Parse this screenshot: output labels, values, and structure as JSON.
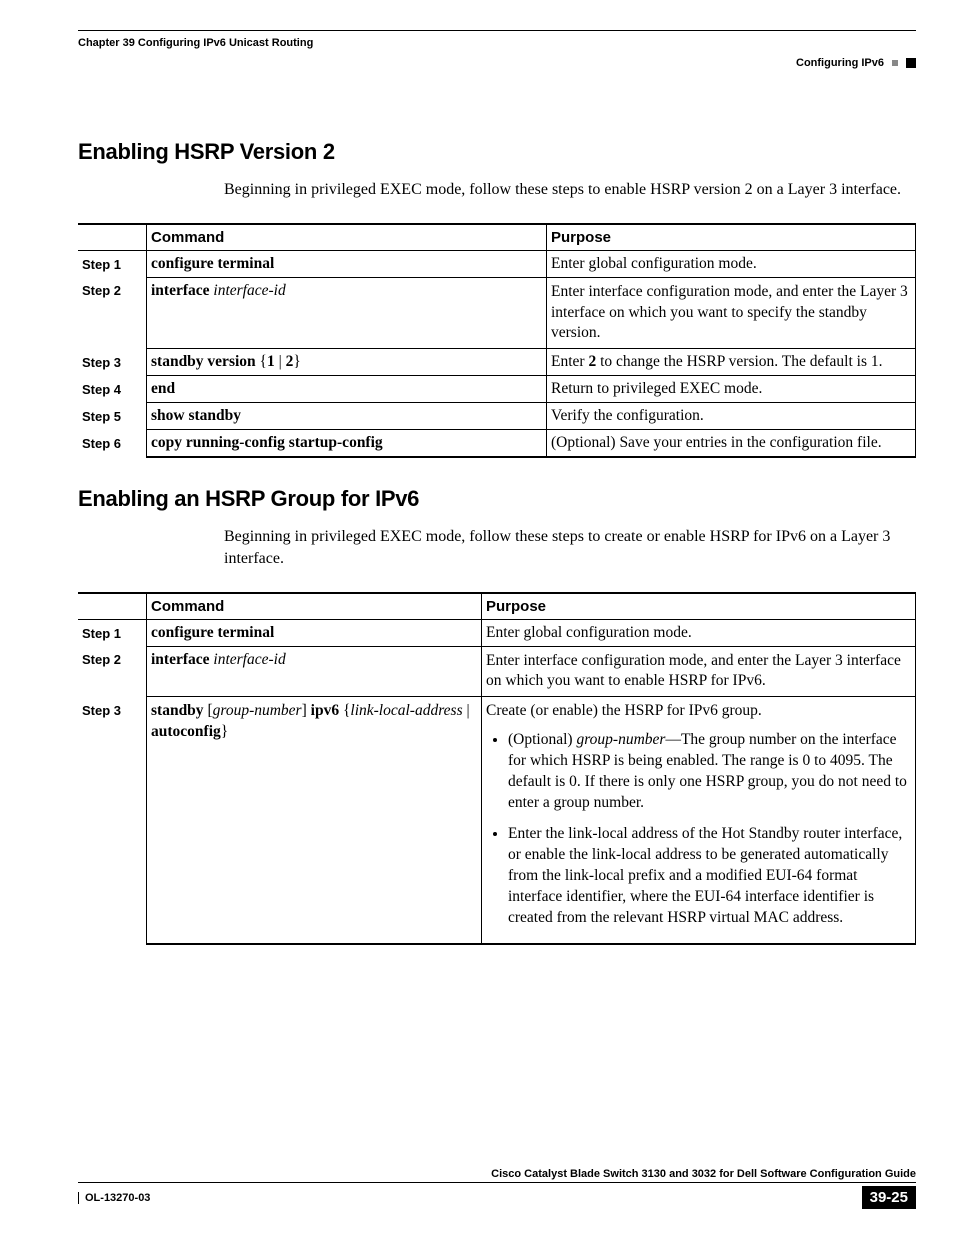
{
  "header": {
    "chapter": "Chapter 39      Configuring IPv6 Unicast Routing",
    "section": "Configuring IPv6"
  },
  "section1": {
    "title": "Enabling HSRP Version 2",
    "intro": "Beginning in privileged EXEC mode, follow these steps to enable HSRP version 2 on a Layer 3 interface.",
    "colCommand": "Command",
    "colPurpose": "Purpose",
    "steps": {
      "s1": "Step 1",
      "s2": "Step 2",
      "s3": "Step 3",
      "s4": "Step 4",
      "s5": "Step 5",
      "s6": "Step 6"
    },
    "row1": {
      "cmd_b": "configure terminal",
      "purpose": "Enter global configuration mode."
    },
    "row2": {
      "cmd_b": "interface",
      "cmd_i": " interface-id",
      "purpose": "Enter interface configuration mode, and enter the Layer 3 interface on which you want to specify the standby version."
    },
    "row3": {
      "cmd_b1": "standby version",
      "cmd_t1": " {",
      "cmd_b2": "1",
      "cmd_t2": " | ",
      "cmd_b3": "2",
      "cmd_t3": "}",
      "purpose_a": "Enter ",
      "purpose_b": "2",
      "purpose_c": " to change the HSRP version. The default is 1."
    },
    "row4": {
      "cmd_b": "end",
      "purpose": "Return to privileged EXEC mode."
    },
    "row5": {
      "cmd_b": "show standby",
      "purpose": "Verify the configuration."
    },
    "row6": {
      "cmd_b": "copy running-config startup-config",
      "purpose": "(Optional) Save your entries in the configuration file."
    }
  },
  "section2": {
    "title": "Enabling an HSRP Group for IPv6",
    "intro": "Beginning in privileged EXEC mode, follow these steps to create or enable HSRP for IPv6 on a Layer 3 interface.",
    "colCommand": "Command",
    "colPurpose": "Purpose",
    "steps": {
      "s1": "Step 1",
      "s2": "Step 2",
      "s3": "Step 3"
    },
    "row1": {
      "cmd_b": "configure terminal",
      "purpose": "Enter global configuration mode."
    },
    "row2": {
      "cmd_b": "interface",
      "cmd_i": " interface-id",
      "purpose": "Enter interface configuration mode, and enter the Layer 3 interface on which you want to enable HSRP for IPv6."
    },
    "row3": {
      "cmd_b1": "standby",
      "cmd_t1": " [",
      "cmd_i1": "group-number",
      "cmd_t2": "] ",
      "cmd_b2": "ipv6",
      "cmd_t3": " {",
      "cmd_i2": "link-local-address",
      "cmd_t4": " | ",
      "cmd_b3": "autoconfig",
      "cmd_t5": "}",
      "purpose_lead": "Create (or enable) the HSRP for IPv6 group.",
      "li1_a": "(Optional) ",
      "li1_i": "group-number",
      "li1_b": "—The group number on the interface for which HSRP is being enabled. The range is 0 to 4095. The default is 0. If there is only one HSRP group, you do not need to enter a group number.",
      "li2": "Enter the link-local address of the Hot Standby router interface, or enable the link-local address to be generated automatically from the link-local prefix and a modified EUI-64 format interface identifier, where the EUI-64 interface identifier is created from the relevant HSRP virtual MAC address."
    }
  },
  "footer": {
    "guide": "Cisco Catalyst Blade Switch 3130 and 3032 for Dell Software Configuration Guide",
    "docnum": "OL-13270-03",
    "pagenum": "39-25"
  }
}
